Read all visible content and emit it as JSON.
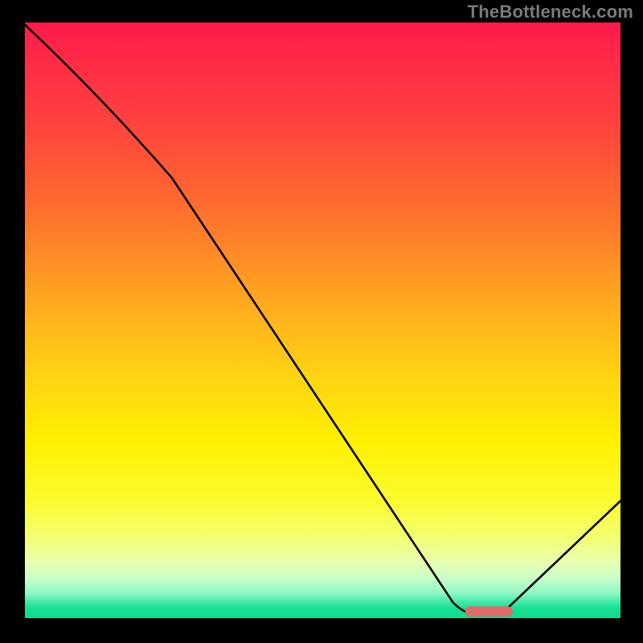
{
  "watermark": "TheBottleneck.com",
  "chart_data": {
    "type": "line",
    "title": "",
    "xlabel": "",
    "ylabel": "",
    "xlim": [
      0,
      100
    ],
    "ylim": [
      0,
      100
    ],
    "grid": false,
    "series": [
      {
        "name": "bottleneck-curve",
        "x": [
          0,
          25,
          72,
          76,
          80,
          100
        ],
        "y": [
          100,
          74,
          3,
          1,
          1,
          20
        ]
      }
    ],
    "marker": {
      "name": "optimal-range",
      "x_start": 74,
      "x_end": 82,
      "y": 1.5
    },
    "background": {
      "type": "vertical-gradient",
      "stops": [
        {
          "pos": 0.0,
          "color": "#ff1a4b"
        },
        {
          "pos": 0.16,
          "color": "#ff4040"
        },
        {
          "pos": 0.4,
          "color": "#ff8f25"
        },
        {
          "pos": 0.6,
          "color": "#ffd612"
        },
        {
          "pos": 0.8,
          "color": "#fbfb2f"
        },
        {
          "pos": 0.93,
          "color": "#c9ffc8"
        },
        {
          "pos": 1.0,
          "color": "#0fd98c"
        }
      ]
    }
  }
}
